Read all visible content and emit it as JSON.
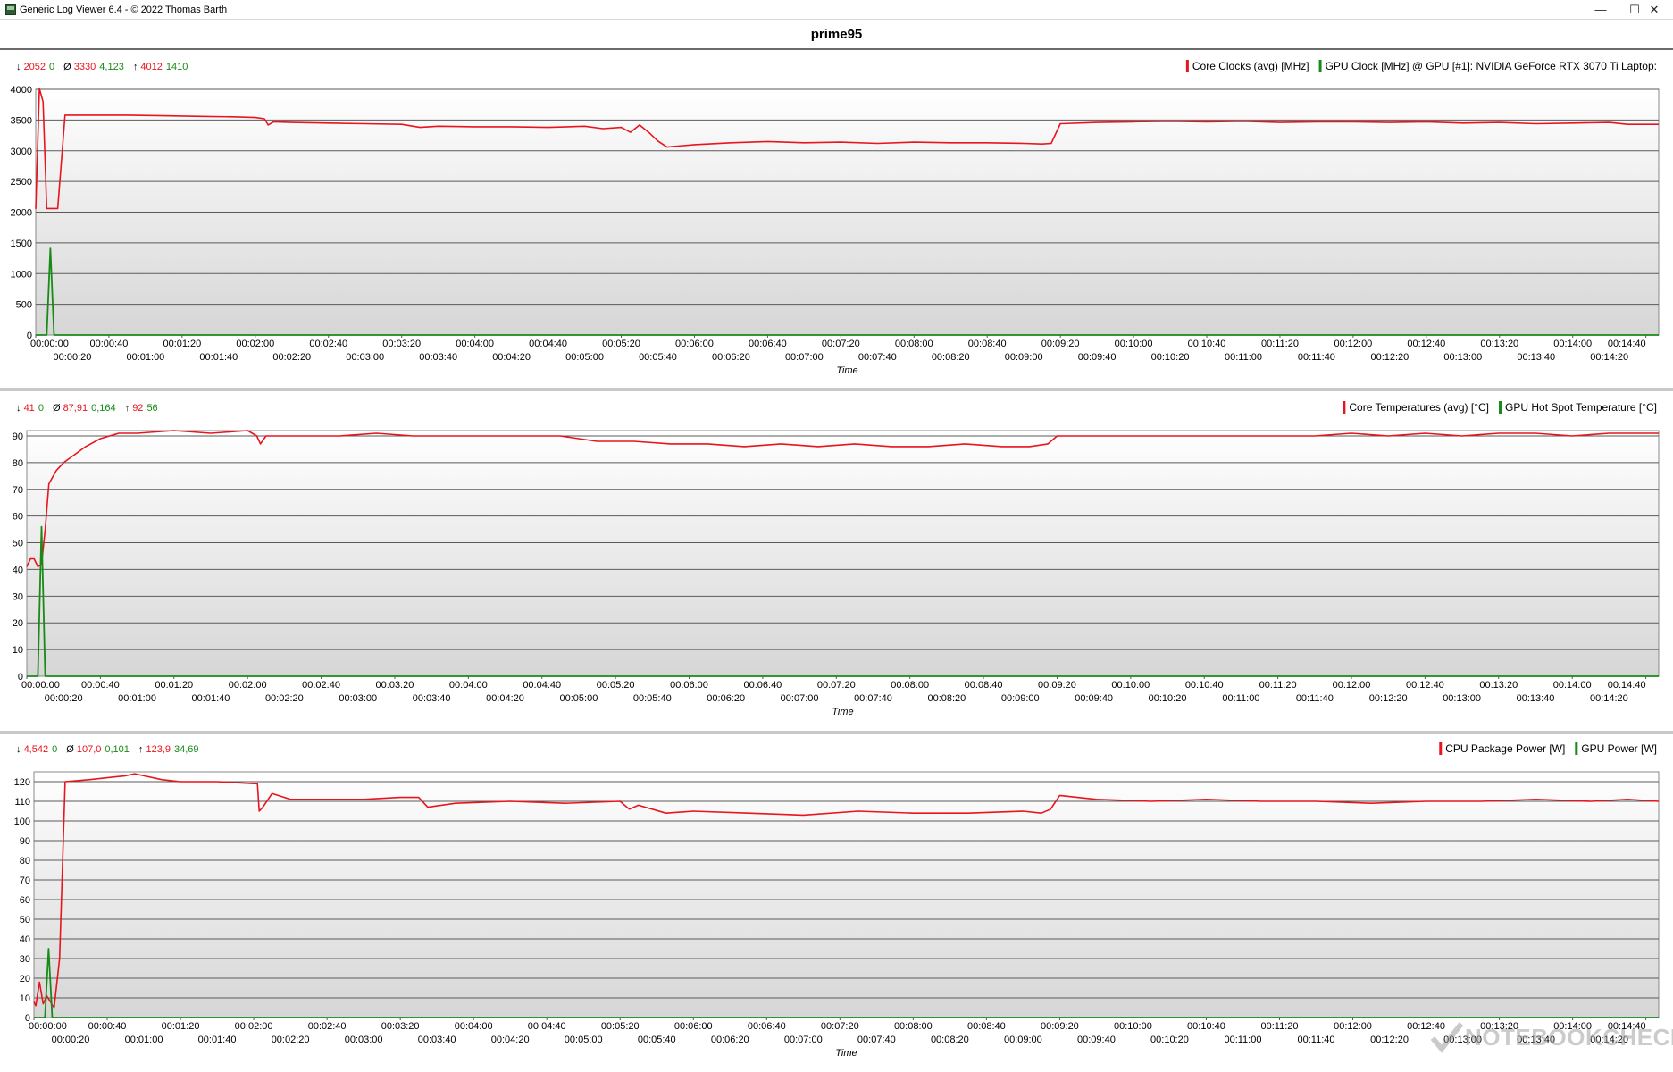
{
  "window": {
    "title": "Generic Log Viewer 6.4 - © 2022 Thomas Barth",
    "buttons": {
      "minimize": "—",
      "maximize": "☐",
      "close": "✕"
    }
  },
  "document_title": "prime95",
  "watermark": "NOTEBOOKCHECK",
  "colors": {
    "red": "#e8141e",
    "green": "#178a17"
  },
  "chart_data": [
    {
      "type": "line",
      "stats": {
        "min": [
          "2052",
          "0"
        ],
        "avg": [
          "3330",
          "4,123"
        ],
        "max": [
          "4012",
          "1410"
        ]
      },
      "legend": [
        "Core Clocks (avg) [MHz]",
        "GPU Clock [MHz] @ GPU [#1]: NVIDIA GeForce RTX 3070 Ti Laptop:"
      ],
      "xlabel": "Time",
      "ylim": [
        0,
        4000
      ],
      "yticks": [
        0,
        500,
        1000,
        1500,
        2000,
        2500,
        3000,
        3500,
        4000
      ],
      "xticks_top": [
        "00:00:00",
        "00:00:40",
        "00:01:20",
        "00:02:00",
        "00:02:40",
        "00:03:20",
        "00:04:00",
        "00:04:40",
        "00:05:20",
        "00:06:00",
        "00:06:40",
        "00:07:20",
        "00:08:00",
        "00:08:40",
        "00:09:20",
        "00:10:00",
        "00:10:40",
        "00:11:20",
        "00:12:00",
        "00:12:40",
        "00:13:20",
        "00:14:00",
        "00:14:40"
      ],
      "xticks_bottom": [
        "00:00:20",
        "00:01:00",
        "00:01:40",
        "00:02:20",
        "00:03:00",
        "00:03:40",
        "00:04:20",
        "00:05:00",
        "00:05:40",
        "00:06:20",
        "00:07:00",
        "00:07:40",
        "00:08:20",
        "00:09:00",
        "00:09:40",
        "00:10:20",
        "00:11:00",
        "00:11:40",
        "00:12:20",
        "00:13:00",
        "00:13:40",
        "00:14:20"
      ],
      "x_max_seconds": 887,
      "series": [
        {
          "name": "Core Clocks (avg) [MHz]",
          "color": "#e8141e",
          "points": [
            [
              0,
              2052
            ],
            [
              2,
              4012
            ],
            [
              4,
              3800
            ],
            [
              6,
              2060
            ],
            [
              8,
              2060
            ],
            [
              12,
              2060
            ],
            [
              16,
              3580
            ],
            [
              30,
              3580
            ],
            [
              50,
              3580
            ],
            [
              70,
              3570
            ],
            [
              90,
              3560
            ],
            [
              110,
              3550
            ],
            [
              120,
              3540
            ],
            [
              125,
              3520
            ],
            [
              127,
              3420
            ],
            [
              130,
              3470
            ],
            [
              140,
              3460
            ],
            [
              160,
              3450
            ],
            [
              180,
              3440
            ],
            [
              200,
              3430
            ],
            [
              210,
              3380
            ],
            [
              220,
              3400
            ],
            [
              240,
              3390
            ],
            [
              260,
              3390
            ],
            [
              280,
              3380
            ],
            [
              300,
              3400
            ],
            [
              310,
              3360
            ],
            [
              320,
              3380
            ],
            [
              325,
              3300
            ],
            [
              330,
              3420
            ],
            [
              335,
              3300
            ],
            [
              340,
              3160
            ],
            [
              345,
              3060
            ],
            [
              360,
              3100
            ],
            [
              380,
              3130
            ],
            [
              400,
              3150
            ],
            [
              420,
              3130
            ],
            [
              440,
              3140
            ],
            [
              460,
              3120
            ],
            [
              480,
              3140
            ],
            [
              500,
              3130
            ],
            [
              520,
              3130
            ],
            [
              540,
              3120
            ],
            [
              550,
              3110
            ],
            [
              555,
              3120
            ],
            [
              560,
              3440
            ],
            [
              580,
              3460
            ],
            [
              600,
              3470
            ],
            [
              620,
              3480
            ],
            [
              640,
              3470
            ],
            [
              660,
              3480
            ],
            [
              680,
              3460
            ],
            [
              700,
              3470
            ],
            [
              720,
              3470
            ],
            [
              740,
              3460
            ],
            [
              760,
              3470
            ],
            [
              780,
              3450
            ],
            [
              800,
              3460
            ],
            [
              820,
              3440
            ],
            [
              840,
              3450
            ],
            [
              860,
              3460
            ],
            [
              870,
              3430
            ],
            [
              887,
              3430
            ]
          ]
        },
        {
          "name": "GPU Clock [MHz] @ GPU [#1]: NVIDIA GeForce RTX 3070 Ti Laptop:",
          "color": "#178a17",
          "points": [
            [
              0,
              0
            ],
            [
              6,
              0
            ],
            [
              8,
              1410
            ],
            [
              10,
              0
            ],
            [
              887,
              0
            ]
          ]
        }
      ]
    },
    {
      "type": "line",
      "stats": {
        "min": [
          "41",
          "0"
        ],
        "avg": [
          "87,91",
          "0,164"
        ],
        "max": [
          "92",
          "56"
        ]
      },
      "legend": [
        "Core Temperatures (avg) [°C]",
        "GPU Hot Spot Temperature [°C]"
      ],
      "xlabel": "Time",
      "ylim": [
        0,
        92
      ],
      "yticks": [
        0,
        10,
        20,
        30,
        40,
        50,
        60,
        70,
        80,
        90
      ],
      "xticks_top": [
        "00:00:00",
        "00:00:40",
        "00:01:20",
        "00:02:00",
        "00:02:40",
        "00:03:20",
        "00:04:00",
        "00:04:40",
        "00:05:20",
        "00:06:00",
        "00:06:40",
        "00:07:20",
        "00:08:00",
        "00:08:40",
        "00:09:20",
        "00:10:00",
        "00:10:40",
        "00:11:20",
        "00:12:00",
        "00:12:40",
        "00:13:20",
        "00:14:00",
        "00:14:40"
      ],
      "xticks_bottom": [
        "00:00:20",
        "00:01:00",
        "00:01:40",
        "00:02:20",
        "00:03:00",
        "00:03:40",
        "00:04:20",
        "00:05:00",
        "00:05:40",
        "00:06:20",
        "00:07:00",
        "00:07:40",
        "00:08:20",
        "00:09:00",
        "00:09:40",
        "00:10:20",
        "00:11:00",
        "00:11:40",
        "00:12:20",
        "00:13:00",
        "00:13:40",
        "00:14:20"
      ],
      "x_max_seconds": 887,
      "series": [
        {
          "name": "Core Temperatures (avg) [°C]",
          "color": "#e8141e",
          "points": [
            [
              0,
              41
            ],
            [
              2,
              44
            ],
            [
              4,
              44
            ],
            [
              6,
              41
            ],
            [
              8,
              42
            ],
            [
              10,
              55
            ],
            [
              12,
              72
            ],
            [
              16,
              77
            ],
            [
              20,
              80
            ],
            [
              26,
              83
            ],
            [
              32,
              86
            ],
            [
              40,
              89
            ],
            [
              50,
              91
            ],
            [
              60,
              91
            ],
            [
              80,
              92
            ],
            [
              100,
              91
            ],
            [
              120,
              92
            ],
            [
              125,
              90
            ],
            [
              127,
              87
            ],
            [
              130,
              90
            ],
            [
              150,
              90
            ],
            [
              170,
              90
            ],
            [
              190,
              91
            ],
            [
              210,
              90
            ],
            [
              230,
              90
            ],
            [
              250,
              90
            ],
            [
              270,
              90
            ],
            [
              290,
              90
            ],
            [
              300,
              89
            ],
            [
              310,
              88
            ],
            [
              330,
              88
            ],
            [
              350,
              87
            ],
            [
              370,
              87
            ],
            [
              390,
              86
            ],
            [
              410,
              87
            ],
            [
              430,
              86
            ],
            [
              450,
              87
            ],
            [
              470,
              86
            ],
            [
              490,
              86
            ],
            [
              510,
              87
            ],
            [
              530,
              86
            ],
            [
              545,
              86
            ],
            [
              555,
              87
            ],
            [
              560,
              90
            ],
            [
              580,
              90
            ],
            [
              600,
              90
            ],
            [
              620,
              90
            ],
            [
              640,
              90
            ],
            [
              660,
              90
            ],
            [
              680,
              90
            ],
            [
              700,
              90
            ],
            [
              720,
              91
            ],
            [
              740,
              90
            ],
            [
              760,
              91
            ],
            [
              780,
              90
            ],
            [
              800,
              91
            ],
            [
              820,
              91
            ],
            [
              840,
              90
            ],
            [
              860,
              91
            ],
            [
              887,
              91
            ]
          ]
        },
        {
          "name": "GPU Hot Spot Temperature [°C]",
          "color": "#178a17",
          "points": [
            [
              0,
              0
            ],
            [
              6,
              0
            ],
            [
              8,
              56
            ],
            [
              10,
              0
            ],
            [
              887,
              0
            ]
          ]
        }
      ]
    },
    {
      "type": "line",
      "stats": {
        "min": [
          "4,542",
          "0"
        ],
        "avg": [
          "107,0",
          "0,101"
        ],
        "max": [
          "123,9",
          "34,69"
        ]
      },
      "legend": [
        "CPU Package Power [W]",
        "GPU Power [W]"
      ],
      "xlabel": "Time",
      "ylim": [
        0,
        125
      ],
      "yticks": [
        0,
        10,
        20,
        30,
        40,
        50,
        60,
        70,
        80,
        90,
        100,
        110,
        120
      ],
      "xticks_top": [
        "00:00:00",
        "00:00:40",
        "00:01:20",
        "00:02:00",
        "00:02:40",
        "00:03:20",
        "00:04:00",
        "00:04:40",
        "00:05:20",
        "00:06:00",
        "00:06:40",
        "00:07:20",
        "00:08:00",
        "00:08:40",
        "00:09:20",
        "00:10:00",
        "00:10:40",
        "00:11:20",
        "00:12:00",
        "00:12:40",
        "00:13:20",
        "00:14:00",
        "00:14:40"
      ],
      "xticks_bottom": [
        "00:00:20",
        "00:01:00",
        "00:01:40",
        "00:02:20",
        "00:03:00",
        "00:03:40",
        "00:04:20",
        "00:05:00",
        "00:05:40",
        "00:06:20",
        "00:07:00",
        "00:07:40",
        "00:08:20",
        "00:09:00",
        "00:09:40",
        "00:10:20",
        "00:11:00",
        "00:11:40",
        "00:12:20",
        "00:13:00",
        "00:13:40",
        "00:14:20"
      ],
      "x_max_seconds": 887,
      "series": [
        {
          "name": "CPU Package Power [W]",
          "color": "#e8141e",
          "points": [
            [
              0,
              8
            ],
            [
              1,
              6
            ],
            [
              3,
              18
            ],
            [
              5,
              7
            ],
            [
              7,
              11
            ],
            [
              9,
              8
            ],
            [
              11,
              5
            ],
            [
              14,
              30
            ],
            [
              17,
              120
            ],
            [
              30,
              121
            ],
            [
              50,
              123
            ],
            [
              55,
              124
            ],
            [
              60,
              123
            ],
            [
              70,
              121
            ],
            [
              80,
              120
            ],
            [
              100,
              120
            ],
            [
              120,
              119
            ],
            [
              122,
              119
            ],
            [
              123,
              105
            ],
            [
              125,
              107
            ],
            [
              130,
              114
            ],
            [
              140,
              111
            ],
            [
              160,
              111
            ],
            [
              180,
              111
            ],
            [
              200,
              112
            ],
            [
              210,
              112
            ],
            [
              215,
              107
            ],
            [
              230,
              109
            ],
            [
              260,
              110
            ],
            [
              290,
              109
            ],
            [
              320,
              110
            ],
            [
              325,
              106
            ],
            [
              330,
              108
            ],
            [
              345,
              104
            ],
            [
              360,
              105
            ],
            [
              390,
              104
            ],
            [
              420,
              103
            ],
            [
              450,
              105
            ],
            [
              480,
              104
            ],
            [
              510,
              104
            ],
            [
              540,
              105
            ],
            [
              550,
              104
            ],
            [
              555,
              106
            ],
            [
              560,
              113
            ],
            [
              580,
              111
            ],
            [
              610,
              110
            ],
            [
              640,
              111
            ],
            [
              670,
              110
            ],
            [
              700,
              110
            ],
            [
              730,
              109
            ],
            [
              760,
              110
            ],
            [
              790,
              110
            ],
            [
              820,
              111
            ],
            [
              850,
              110
            ],
            [
              870,
              111
            ],
            [
              887,
              110
            ]
          ]
        },
        {
          "name": "GPU Power [W]",
          "color": "#178a17",
          "points": [
            [
              0,
              0
            ],
            [
              6,
              0
            ],
            [
              8,
              35
            ],
            [
              10,
              0
            ],
            [
              887,
              0
            ]
          ]
        }
      ]
    }
  ]
}
